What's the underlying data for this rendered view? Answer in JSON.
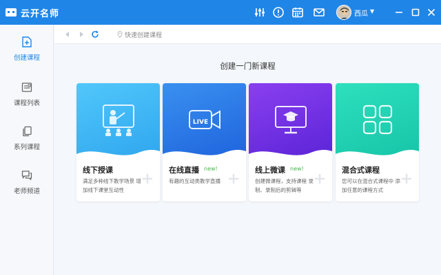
{
  "app": {
    "title": "云开名师"
  },
  "header": {
    "username": "西瓜"
  },
  "sidebar": {
    "items": [
      {
        "label": "创建课程"
      },
      {
        "label": "课程列表"
      },
      {
        "label": "系列课程"
      },
      {
        "label": "老师频道"
      }
    ]
  },
  "toolbar": {
    "breadcrumb": "快速创建课程"
  },
  "main": {
    "title": "创建一门新课程",
    "cards": [
      {
        "name": "线下授课",
        "badge": "",
        "desc": "满足多种线下教学场景 增加线下课堂互动性",
        "icon_text": ""
      },
      {
        "name": "在线直播",
        "badge": "new!",
        "desc": "有趣的互动类教学直播",
        "icon_text": "LIVE"
      },
      {
        "name": "线上微课",
        "badge": "new!",
        "desc": "创建微课程，支持课程 录制、录制后的剪辑等",
        "icon_text": ""
      },
      {
        "name": "混合式课程",
        "badge": "",
        "desc": "您可以在混合式课程中 添加任意的课程方式",
        "icon_text": ""
      }
    ]
  },
  "colors": {
    "accent": "#1f86e8",
    "card1": "#3db8f5",
    "card2": "#2b7de9",
    "card3": "#7a32e0",
    "card4": "#1fd3b4",
    "badge": "#40b84a"
  }
}
